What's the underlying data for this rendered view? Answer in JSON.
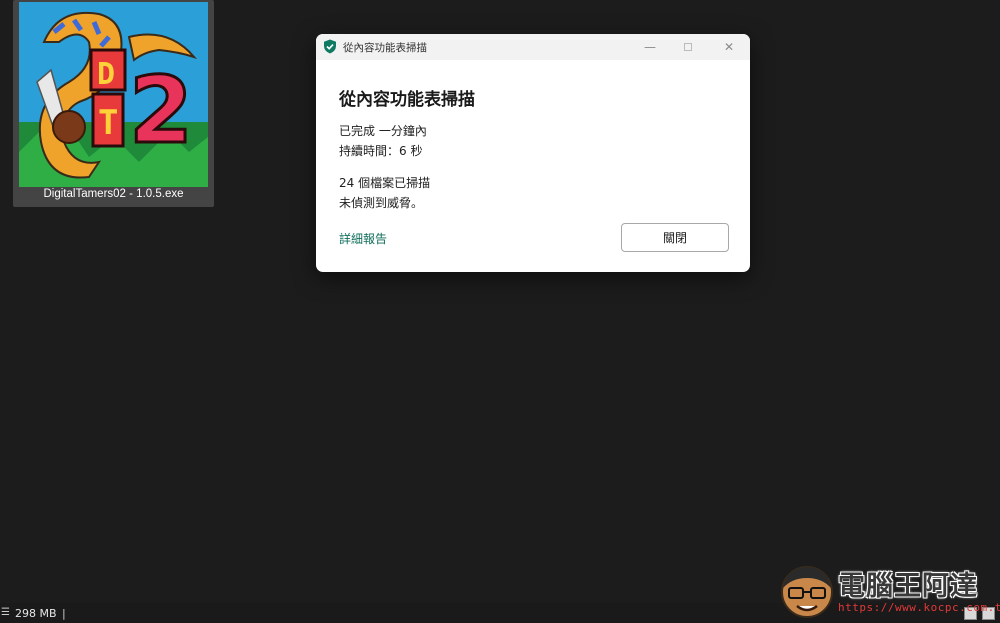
{
  "file_tile": {
    "name": "DigitalTamers02 - 1.0.5.exe",
    "logo_text": "DT2"
  },
  "dialog": {
    "window_title": "從內容功能表掃描",
    "heading": "從內容功能表掃描",
    "completed": "已完成 一分鐘內",
    "duration": "持續時間：6 秒",
    "files_scanned": "24 個檔案已掃描",
    "result": "未偵測到威脅。",
    "details_link": "詳細報告",
    "close_button": "關閉",
    "minimize_glyph": "—",
    "close_glyph": "✕",
    "accent_color": "#0f6e5a"
  },
  "statusbar": {
    "size": "298 MB",
    "separator": "|"
  },
  "watermark": {
    "brand": "電腦王阿達",
    "url": "https://www.kocpc.com.tw"
  }
}
